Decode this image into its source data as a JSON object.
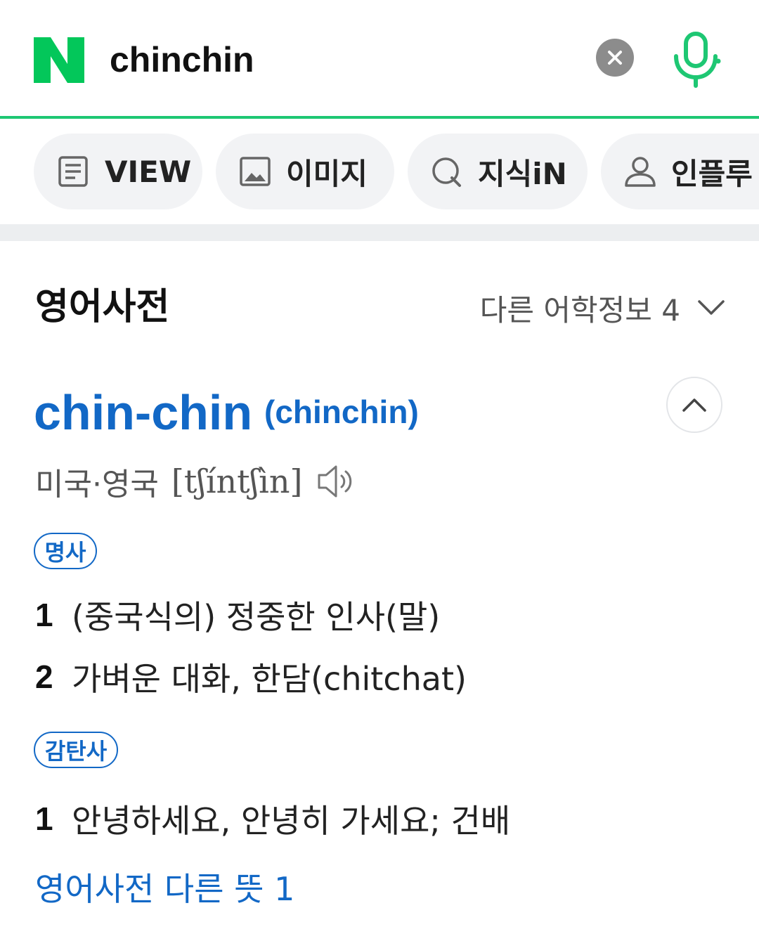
{
  "search": {
    "query": "chinchin",
    "logo_icon": "naver-n-logo",
    "clear_icon": "close-icon",
    "voice_icon": "microphone-icon",
    "accent_color": "#1ec773"
  },
  "tabs": [
    {
      "label": "VIEW",
      "icon": "document-icon"
    },
    {
      "label": "이미지",
      "icon": "image-icon"
    },
    {
      "label": "지식iN",
      "icon": "q-search-icon"
    },
    {
      "label": "인플루",
      "icon": "person-icon"
    }
  ],
  "dictionary": {
    "title": "영어사전",
    "other_info": "다른 어학정보 4",
    "entry": {
      "word": "chin-chin",
      "original": "(chinchin)",
      "pron_region": "미국·영국",
      "pron_ipa": "[tʃíntʃìn]"
    },
    "noun": {
      "label": "명사",
      "senses": [
        {
          "num": "1",
          "text": "(중국식의) 정중한 인사(말)"
        },
        {
          "num": "2",
          "text": "가벼운 대화, 한담(chitchat)"
        }
      ]
    },
    "interjection": {
      "label": "감탄사",
      "senses": [
        {
          "num": "1",
          "text": "안녕하세요, 안녕히 가세요; 건배"
        }
      ]
    },
    "more_link": "영어사전 다른 뜻 1",
    "link_color": "#1268c6"
  }
}
